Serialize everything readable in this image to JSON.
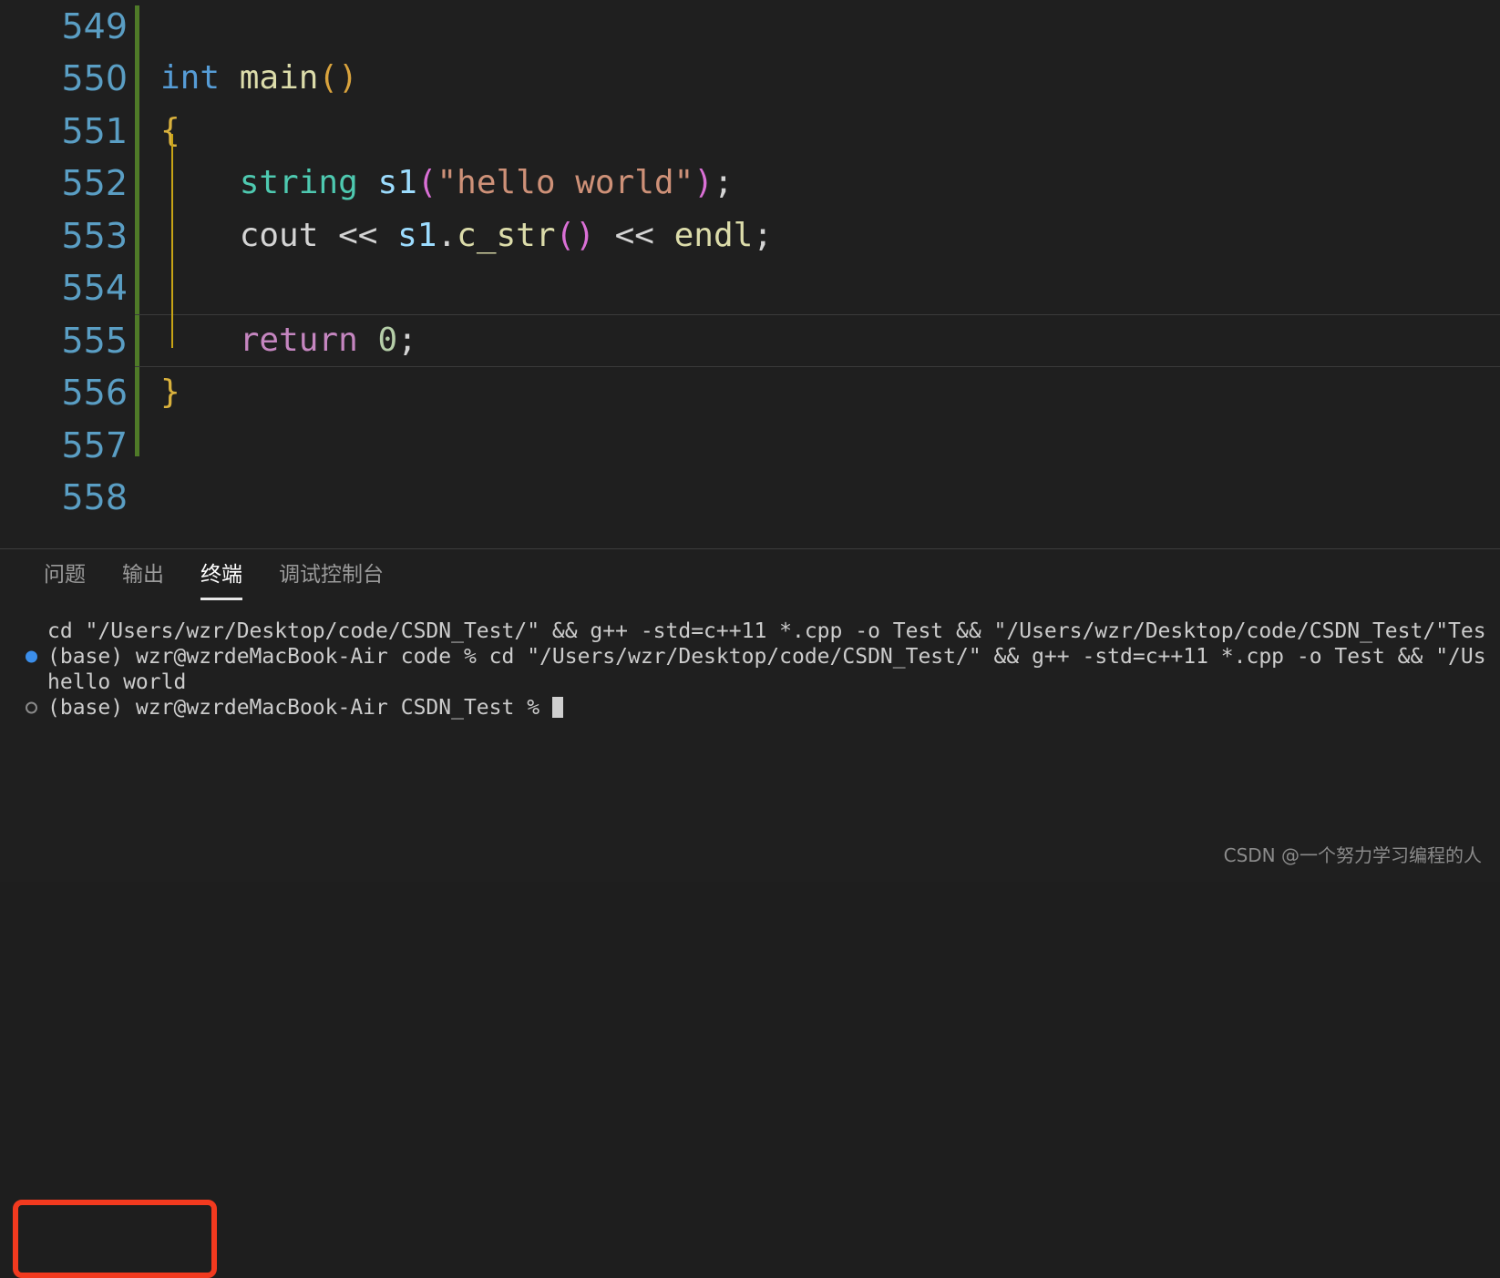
{
  "editor": {
    "fold_strip_color": "#4f7a28",
    "indent_guide_color": "#c8a415",
    "lines": [
      {
        "num": "549",
        "indent": 0,
        "current": false,
        "tokens": []
      },
      {
        "num": "550",
        "indent": 0,
        "current": false,
        "tokens": [
          {
            "t": "int",
            "c": "tok-kw"
          },
          {
            "t": " ",
            "c": "tok-plain"
          },
          {
            "t": "main",
            "c": "tok-fn"
          },
          {
            "t": "()",
            "c": "tok-paren"
          }
        ]
      },
      {
        "num": "551",
        "indent": 0,
        "current": false,
        "tokens": [
          {
            "t": "{",
            "c": "tok-brace"
          }
        ]
      },
      {
        "num": "552",
        "indent": 1,
        "current": false,
        "tokens": [
          {
            "t": "    ",
            "c": "tok-plain"
          },
          {
            "t": "string",
            "c": "tok-type"
          },
          {
            "t": " ",
            "c": "tok-plain"
          },
          {
            "t": "s1",
            "c": "tok-var"
          },
          {
            "t": "(",
            "c": "tok-paren2"
          },
          {
            "t": "\"hello world\"",
            "c": "tok-str"
          },
          {
            "t": ")",
            "c": "tok-paren2"
          },
          {
            "t": ";",
            "c": "tok-punct"
          }
        ]
      },
      {
        "num": "553",
        "indent": 1,
        "current": false,
        "tokens": [
          {
            "t": "    ",
            "c": "tok-plain"
          },
          {
            "t": "cout",
            "c": "tok-plain"
          },
          {
            "t": " << ",
            "c": "tok-op"
          },
          {
            "t": "s1",
            "c": "tok-var"
          },
          {
            "t": ".",
            "c": "tok-punct"
          },
          {
            "t": "c_str",
            "c": "tok-fn"
          },
          {
            "t": "()",
            "c": "tok-paren2"
          },
          {
            "t": " << ",
            "c": "tok-op"
          },
          {
            "t": "endl",
            "c": "tok-fn"
          },
          {
            "t": ";",
            "c": "tok-punct"
          }
        ]
      },
      {
        "num": "554",
        "indent": 1,
        "current": false,
        "tokens": []
      },
      {
        "num": "555",
        "indent": 1,
        "current": true,
        "tokens": [
          {
            "t": "    ",
            "c": "tok-plain"
          },
          {
            "t": "return",
            "c": "tok-ctrl"
          },
          {
            "t": " ",
            "c": "tok-plain"
          },
          {
            "t": "0",
            "c": "tok-num"
          },
          {
            "t": ";",
            "c": "tok-punct"
          }
        ]
      },
      {
        "num": "556",
        "indent": 0,
        "current": false,
        "tokens": [
          {
            "t": "}",
            "c": "tok-brace"
          }
        ]
      },
      {
        "num": "557",
        "indent": 0,
        "current": false,
        "tokens": []
      },
      {
        "num": "558",
        "indent": 0,
        "current": false,
        "tokens": []
      }
    ]
  },
  "panel": {
    "tabs": [
      {
        "label": "问题",
        "active": false
      },
      {
        "label": "输出",
        "active": false
      },
      {
        "label": "终端",
        "active": true
      },
      {
        "label": "调试控制台",
        "active": false
      }
    ]
  },
  "terminal": {
    "lines": [
      {
        "marker": "none",
        "text": "cd \"/Users/wzr/Desktop/code/CSDN_Test/\" && g++ -std=c++11 *.cpp -o Test && \"/Users/wzr/Desktop/code/CSDN_Test/\"Tes",
        "cursor": false
      },
      {
        "marker": "success-filled",
        "text": "(base) wzr@wzrdeMacBook-Air code % cd \"/Users/wzr/Desktop/code/CSDN_Test/\" && g++ -std=c++11 *.cpp -o Test && \"/Us",
        "cursor": false
      },
      {
        "marker": "none",
        "text": "hello world",
        "cursor": false
      },
      {
        "marker": "prompt-hollow",
        "text": "(base) wzr@wzrdeMacBook-Air CSDN_Test % ",
        "cursor": true
      }
    ]
  },
  "annotation": {
    "color": "#f23a1f",
    "highlights": "hello world"
  },
  "watermark": {
    "text": "CSDN @一个努力学习编程的人"
  }
}
